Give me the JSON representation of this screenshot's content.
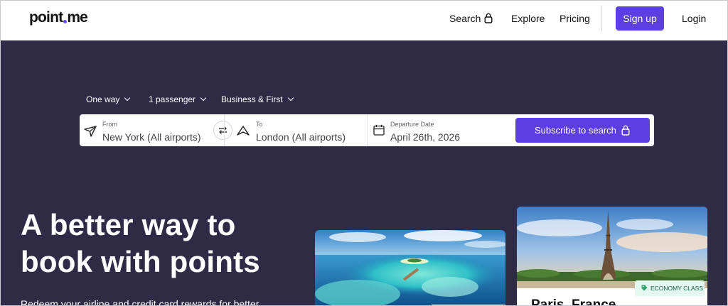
{
  "header": {
    "logo": "pointme",
    "nav": {
      "search": "Search",
      "explore": "Explore",
      "pricing": "Pricing",
      "signup": "Sign up",
      "login": "Login"
    }
  },
  "search_options": {
    "trip_type": "One way",
    "passengers": "1 passenger",
    "cabin": "Business & First"
  },
  "search_form": {
    "from_label": "From",
    "from_value": "New York (All airports)",
    "to_label": "To",
    "to_value": "London (All airports)",
    "date_label": "Departure Date",
    "date_value": "April 26th, 2026",
    "submit": "Subscribe to search"
  },
  "hero": {
    "title_line1": "A better way to",
    "title_line2": "book with points",
    "subtitle": "Redeem your airline and credit card rewards for better"
  },
  "cards": [
    {
      "city": "",
      "image": "maldives-island-photo"
    },
    {
      "city": "Paris, France",
      "badge": "ECONOMY CLASS",
      "image": "eiffel-tower-photo"
    }
  ],
  "colors": {
    "brand": "#5b3fe0",
    "hero_bg": "#2f2a45",
    "badge_bg": "#e3f8ee"
  }
}
